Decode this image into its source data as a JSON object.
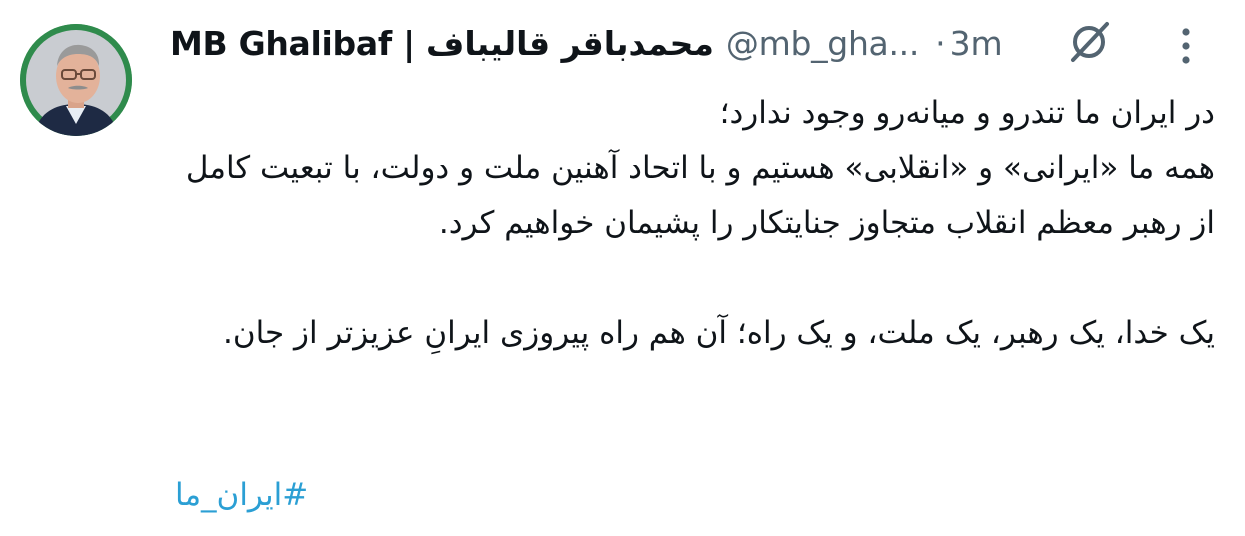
{
  "tweet": {
    "display_name": "MB Ghalibaf | محمدباقر قالیباف",
    "handle": "@mb_gha...",
    "separator": "·",
    "timestamp": "3m",
    "paragraph_1": "در ایران ما تندرو و میانه‌رو وجود ندارد؛\nهمه ما «ایرانی» و «انقلابی» هستیم و با اتحاد آهنین ملت و دولت، با تبعیت کامل از رهبر معظم انقلاب متجاوز جنایتکار را پشیمان خواهیم کرد.",
    "paragraph_2": "یک خدا، یک رهبر، یک ملت، و یک راه؛ آن هم راه پیروزی ایرانِ عزیزتر از جان.",
    "hashtag": "#ایران_ما"
  },
  "icons": {
    "avatar": "profile-photo",
    "grok": "grok-icon",
    "more": "more-options-icon"
  },
  "colors": {
    "text_primary": "#0f1419",
    "text_secondary": "#536471",
    "link": "#2b9fd4",
    "avatar_ring": "#2f8b4c"
  }
}
